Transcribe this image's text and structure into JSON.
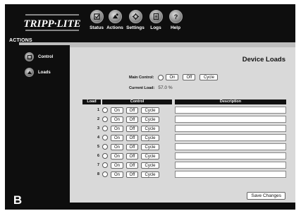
{
  "header": {
    "brand": "TRIPP·LITE",
    "nav": [
      {
        "label": "Status",
        "icon": "status-icon"
      },
      {
        "label": "Actions",
        "icon": "actions-icon"
      },
      {
        "label": "Settings",
        "icon": "settings-icon"
      },
      {
        "label": "Logs",
        "icon": "logs-icon"
      },
      {
        "label": "Help",
        "icon": "help-icon"
      }
    ]
  },
  "section_label": "ACTIONS",
  "sidebar": {
    "items": [
      {
        "label": "Control",
        "icon": "control-icon"
      },
      {
        "label": "Loads",
        "icon": "loads-icon"
      }
    ]
  },
  "main": {
    "title": "Device Loads",
    "main_control_label": "Main Control:",
    "current_load_label": "Current Load:",
    "current_load_value": "57.0 %",
    "buttons": {
      "on": "On",
      "off": "Off",
      "cycle": "Cycle"
    },
    "table": {
      "headers": [
        "Load",
        "Control",
        "Description"
      ],
      "rows": [
        {
          "load": "1",
          "description": ""
        },
        {
          "load": "2",
          "description": ""
        },
        {
          "load": "3",
          "description": ""
        },
        {
          "load": "4",
          "description": ""
        },
        {
          "load": "5",
          "description": ""
        },
        {
          "load": "6",
          "description": ""
        },
        {
          "load": "7",
          "description": ""
        },
        {
          "load": "8",
          "description": ""
        }
      ]
    },
    "save_label": "Save Changes"
  },
  "badge": "B",
  "colors": {
    "frame": "#0e0e0e",
    "panel": "#d9d9d9",
    "bar": "#bdbdbd"
  }
}
